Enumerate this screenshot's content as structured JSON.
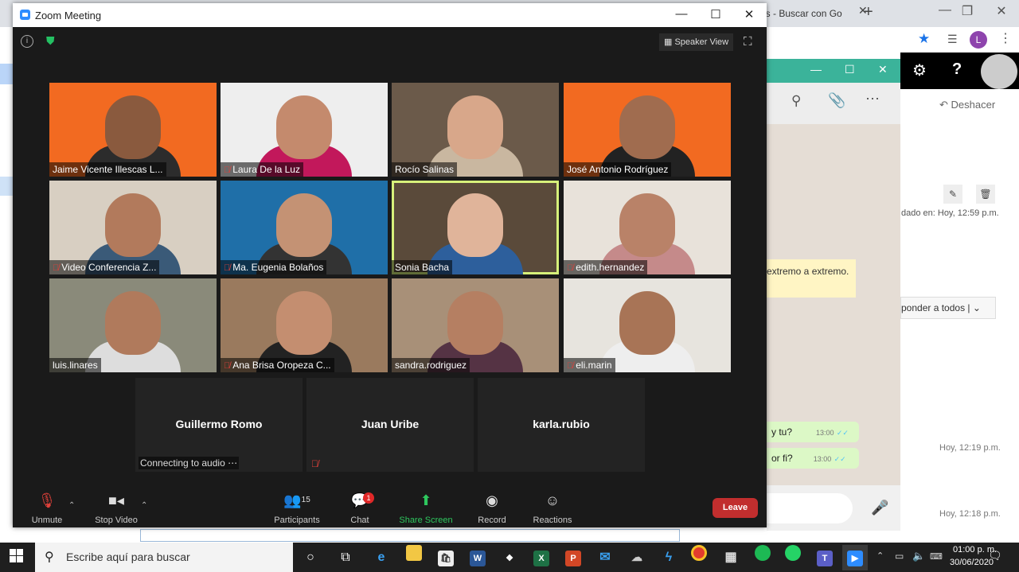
{
  "chrome": {
    "tab_title": "as - Buscar con Go",
    "profile_initial": "L"
  },
  "outlook": {
    "undo": "Deshacer",
    "sent_label": "dado en: Hoy, 12:59 p.m.",
    "reply_all": "ponder a todos",
    "time1": "Hoy, 12:19 p.m.",
    "time2": "Hoy, 12:18 p.m."
  },
  "whatsapp": {
    "system_msg": "extremo a extremo.",
    "msg1": "y tu?",
    "msg1_time": "13:00",
    "msg2": "or fi?",
    "msg2_time": "13:00"
  },
  "zoom": {
    "window_title": "Zoom Meeting",
    "speaker_view": "Speaker View",
    "participants": [
      {
        "name": "Jaime Vicente Illescas L...",
        "muted": false,
        "bg": "#f26a21",
        "skin": "#8a5a3e",
        "shirt": "#2c2c2c"
      },
      {
        "name": "Laura De la Luz",
        "muted": true,
        "bg": "#eeeeee",
        "skin": "#c48a6d",
        "shirt": "#c2185b"
      },
      {
        "name": "Rocío Salinas",
        "muted": false,
        "bg": "#6b5a4a",
        "skin": "#d8a78a",
        "shirt": "#c9b7a0"
      },
      {
        "name": "José Antonio Rodríguez",
        "muted": false,
        "bg": "#f26a21",
        "skin": "#a06c4f",
        "shirt": "#222222"
      },
      {
        "name": "Video Conferencia Z...",
        "muted": true,
        "bg": "#d8cfc2",
        "skin": "#b27a5c",
        "shirt": "#3a5a78"
      },
      {
        "name": "Ma. Eugenia Bolaños",
        "muted": true,
        "bg": "#1f6fa8",
        "skin": "#c49274",
        "shirt": "#333333"
      },
      {
        "name": "Sonia Bacha",
        "muted": false,
        "bg": "#5a4a3a",
        "skin": "#e0b49a",
        "shirt": "#2d5f9c"
      },
      {
        "name": "edith.hernandez",
        "muted": true,
        "bg": "#e8e2da",
        "skin": "#b98268",
        "shirt": "#c58a8a"
      },
      {
        "name": "luis.linares",
        "muted": false,
        "bg": "#8a8a7a",
        "skin": "#b07a5c",
        "shirt": "#dddddd"
      },
      {
        "name": "Ana Brisa Oropeza C...",
        "muted": true,
        "bg": "#9a7a5e",
        "skin": "#c48e70",
        "shirt": "#222222"
      },
      {
        "name": "sandra.rodriguez",
        "muted": false,
        "bg": "#a89078",
        "skin": "#b57f62",
        "shirt": "#553344"
      },
      {
        "name": "eli.marin",
        "muted": true,
        "bg": "#e7e4de",
        "skin": "#a87456",
        "shirt": "#eeeeee"
      }
    ],
    "audio_tiles": [
      {
        "name": "Guillermo Romo",
        "status": "Connecting to audio ⋯"
      },
      {
        "name": "Juan Uribe",
        "status": ""
      },
      {
        "name": "karla.rubio",
        "status": ""
      }
    ],
    "toolbar": {
      "unmute": "Unmute",
      "stop_video": "Stop Video",
      "participants": "Participants",
      "participants_count": "15",
      "chat": "Chat",
      "chat_badge": "1",
      "share": "Share Screen",
      "record": "Record",
      "reactions": "Reactions",
      "leave": "Leave"
    }
  },
  "taskbar": {
    "search_placeholder": "Escribe aquí para buscar",
    "time": "01:00 p. m.",
    "date": "30/06/2020"
  }
}
